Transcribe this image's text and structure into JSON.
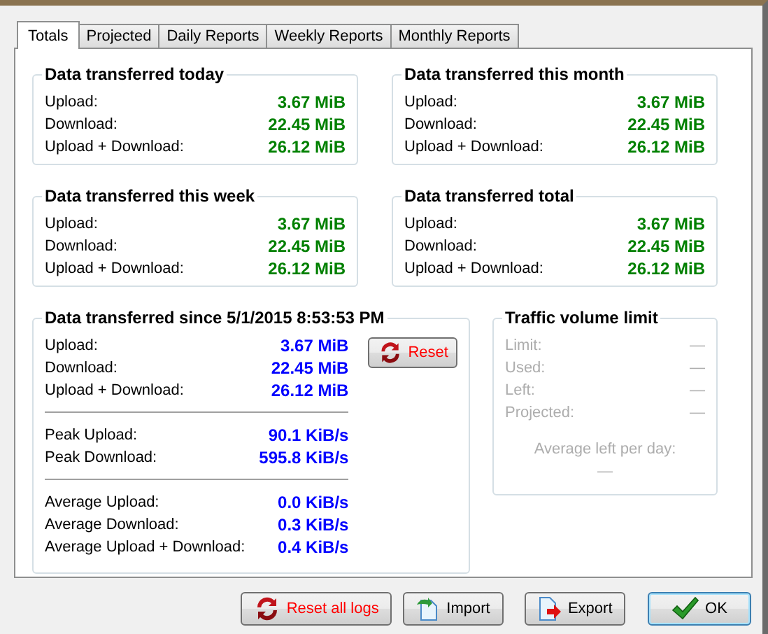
{
  "tabs": [
    {
      "label": "Totals",
      "selected": true
    },
    {
      "label": "Projected",
      "selected": false
    },
    {
      "label": "Daily Reports",
      "selected": false
    },
    {
      "label": "Weekly Reports",
      "selected": false
    },
    {
      "label": "Monthly Reports",
      "selected": false
    }
  ],
  "summary_groups": [
    {
      "title": "Data transferred today",
      "color": "#008000",
      "rows": [
        {
          "label": "Upload:",
          "value": "3.67 MiB"
        },
        {
          "label": "Download:",
          "value": "22.45 MiB"
        },
        {
          "label": "Upload + Download:",
          "value": "26.12 MiB"
        }
      ]
    },
    {
      "title": "Data transferred this month",
      "color": "#008000",
      "rows": [
        {
          "label": "Upload:",
          "value": "3.67 MiB"
        },
        {
          "label": "Download:",
          "value": "22.45 MiB"
        },
        {
          "label": "Upload + Download:",
          "value": "26.12 MiB"
        }
      ]
    },
    {
      "title": "Data transferred this week",
      "color": "#008000",
      "rows": [
        {
          "label": "Upload:",
          "value": "3.67 MiB"
        },
        {
          "label": "Download:",
          "value": "22.45 MiB"
        },
        {
          "label": "Upload + Download:",
          "value": "26.12 MiB"
        }
      ]
    },
    {
      "title": "Data transferred total",
      "color": "#008000",
      "rows": [
        {
          "label": "Upload:",
          "value": "3.67 MiB"
        },
        {
          "label": "Download:",
          "value": "22.45 MiB"
        },
        {
          "label": "Upload + Download:",
          "value": "26.12 MiB"
        }
      ]
    }
  ],
  "session_group": {
    "title": "Data transferred since 5/1/2015 8:53:53 PM",
    "color": "#0000ff",
    "reset_button": "Reset",
    "sections": [
      [
        {
          "label": "Upload:",
          "value": "3.67 MiB"
        },
        {
          "label": "Download:",
          "value": "22.45 MiB"
        },
        {
          "label": "Upload + Download:",
          "value": "26.12 MiB"
        }
      ],
      [
        {
          "label": "Peak Upload:",
          "value": "90.1 KiB/s"
        },
        {
          "label": "Peak Download:",
          "value": "595.8 KiB/s"
        }
      ],
      [
        {
          "label": "Average Upload:",
          "value": "0.0 KiB/s"
        },
        {
          "label": "Average Download:",
          "value": "0.3 KiB/s"
        },
        {
          "label": "Average Upload + Download:",
          "value": "0.4 KiB/s"
        }
      ]
    ]
  },
  "traffic_limit": {
    "title": "Traffic volume limit",
    "disabled": true,
    "rows": [
      {
        "label": "Limit:",
        "value": "—"
      },
      {
        "label": "Used:",
        "value": "—"
      },
      {
        "label": "Left:",
        "value": "—"
      },
      {
        "label": "Projected:",
        "value": "—"
      }
    ],
    "average_label": "Average left per day:",
    "average_value": "—"
  },
  "buttons": [
    {
      "label": "Reset all logs",
      "kind": "reset",
      "default": false
    },
    {
      "label": "Import",
      "kind": "import",
      "default": false
    },
    {
      "label": "Export",
      "kind": "export",
      "default": false
    },
    {
      "label": "OK",
      "kind": "ok",
      "default": true
    }
  ]
}
